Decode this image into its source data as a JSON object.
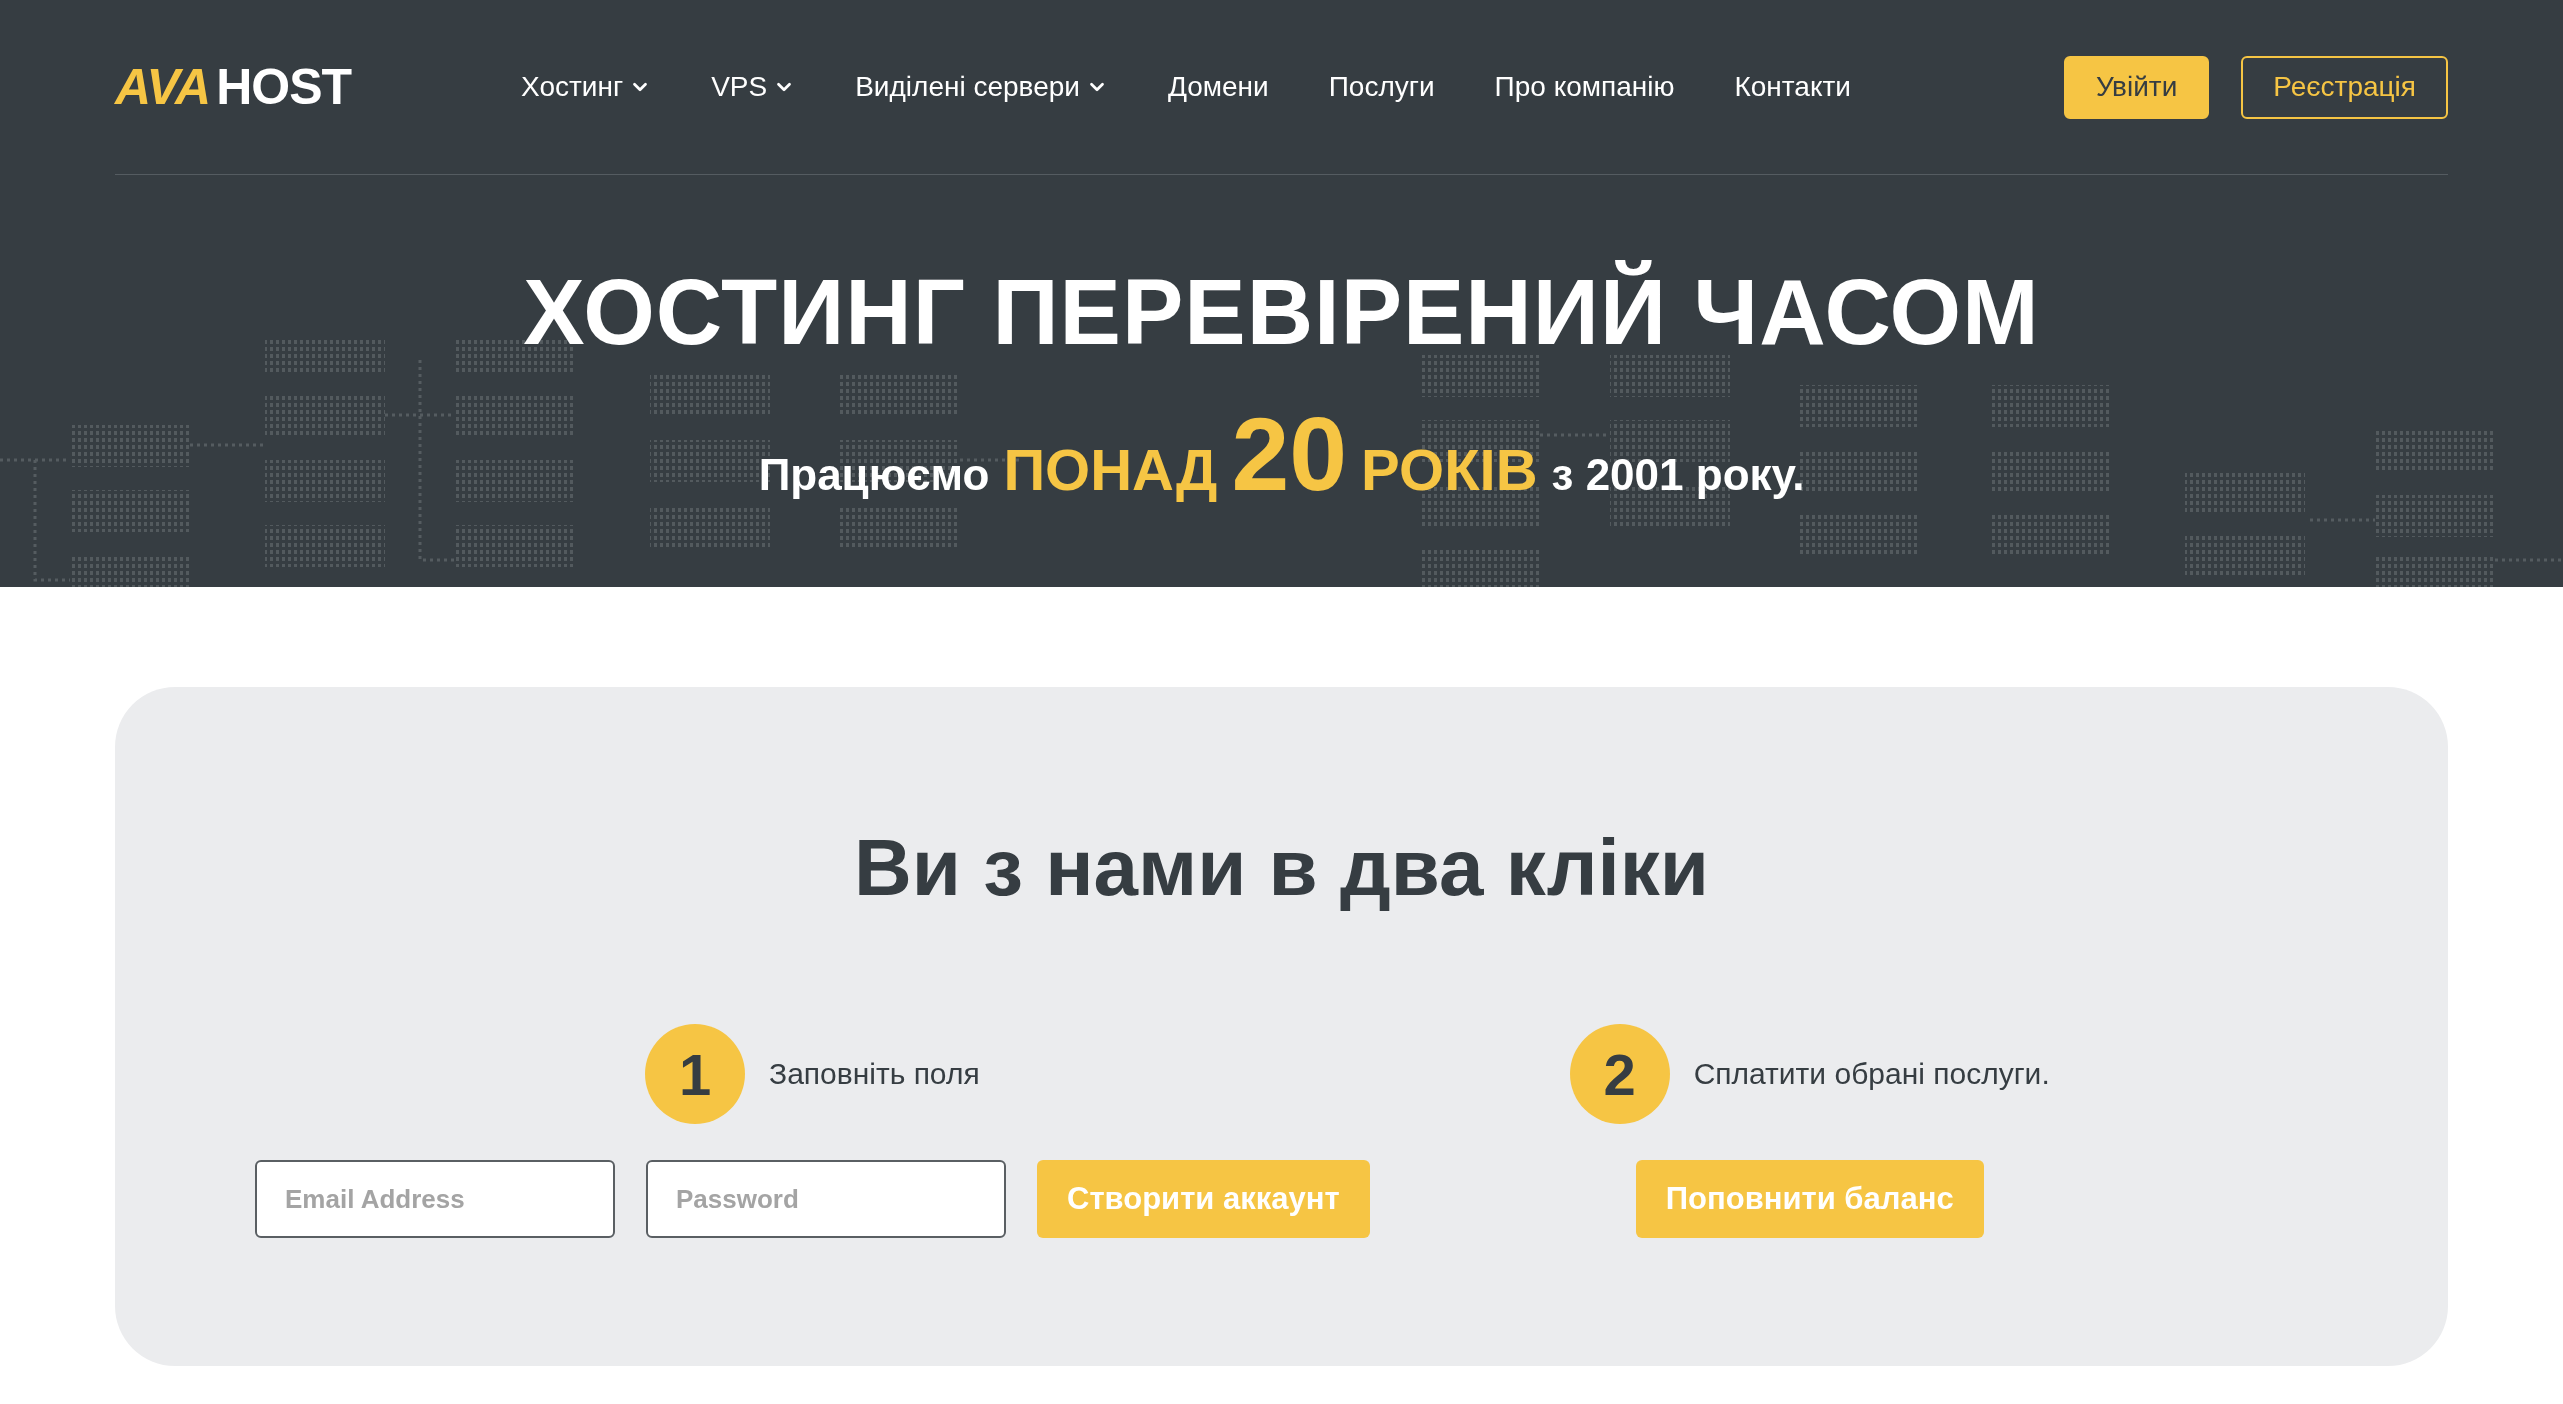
{
  "logo": {
    "mark": "AVA",
    "text": "HOST"
  },
  "nav": [
    {
      "label": "Хостинг",
      "dropdown": true
    },
    {
      "label": "VPS",
      "dropdown": true
    },
    {
      "label": "Виділені сервери",
      "dropdown": true
    },
    {
      "label": "Домени",
      "dropdown": false
    },
    {
      "label": "Послуги",
      "dropdown": false
    },
    {
      "label": "Про компанію",
      "dropdown": false
    },
    {
      "label": "Контакти",
      "dropdown": false
    }
  ],
  "auth_buttons": [
    {
      "label": "Увійти",
      "kind": "primary"
    },
    {
      "label": "Реєстрація",
      "kind": "outline"
    }
  ],
  "hero": {
    "title": "ХОСТИНГ ПЕРЕВІРЕНИЙ ЧАСОМ",
    "subtitle": [
      {
        "text": "Працюємо",
        "kind": "plain"
      },
      {
        "text": "ПОНАД",
        "kind": "accent"
      },
      {
        "text": "20",
        "kind": "number"
      },
      {
        "text": "РОКІВ",
        "kind": "accent"
      },
      {
        "text": "з 2001 року.",
        "kind": "plain"
      }
    ]
  },
  "signup": {
    "title": "Ви з нами в два кліки",
    "steps": [
      {
        "number": "1",
        "text": "Заповніть поля",
        "fields": [
          {
            "placeholder": "Email Address"
          },
          {
            "placeholder": "Password"
          }
        ],
        "button": "Створити аккаунт"
      },
      {
        "number": "2",
        "text": "Сплатити обрані послуги.",
        "button": "Поповнити баланс"
      }
    ]
  }
}
